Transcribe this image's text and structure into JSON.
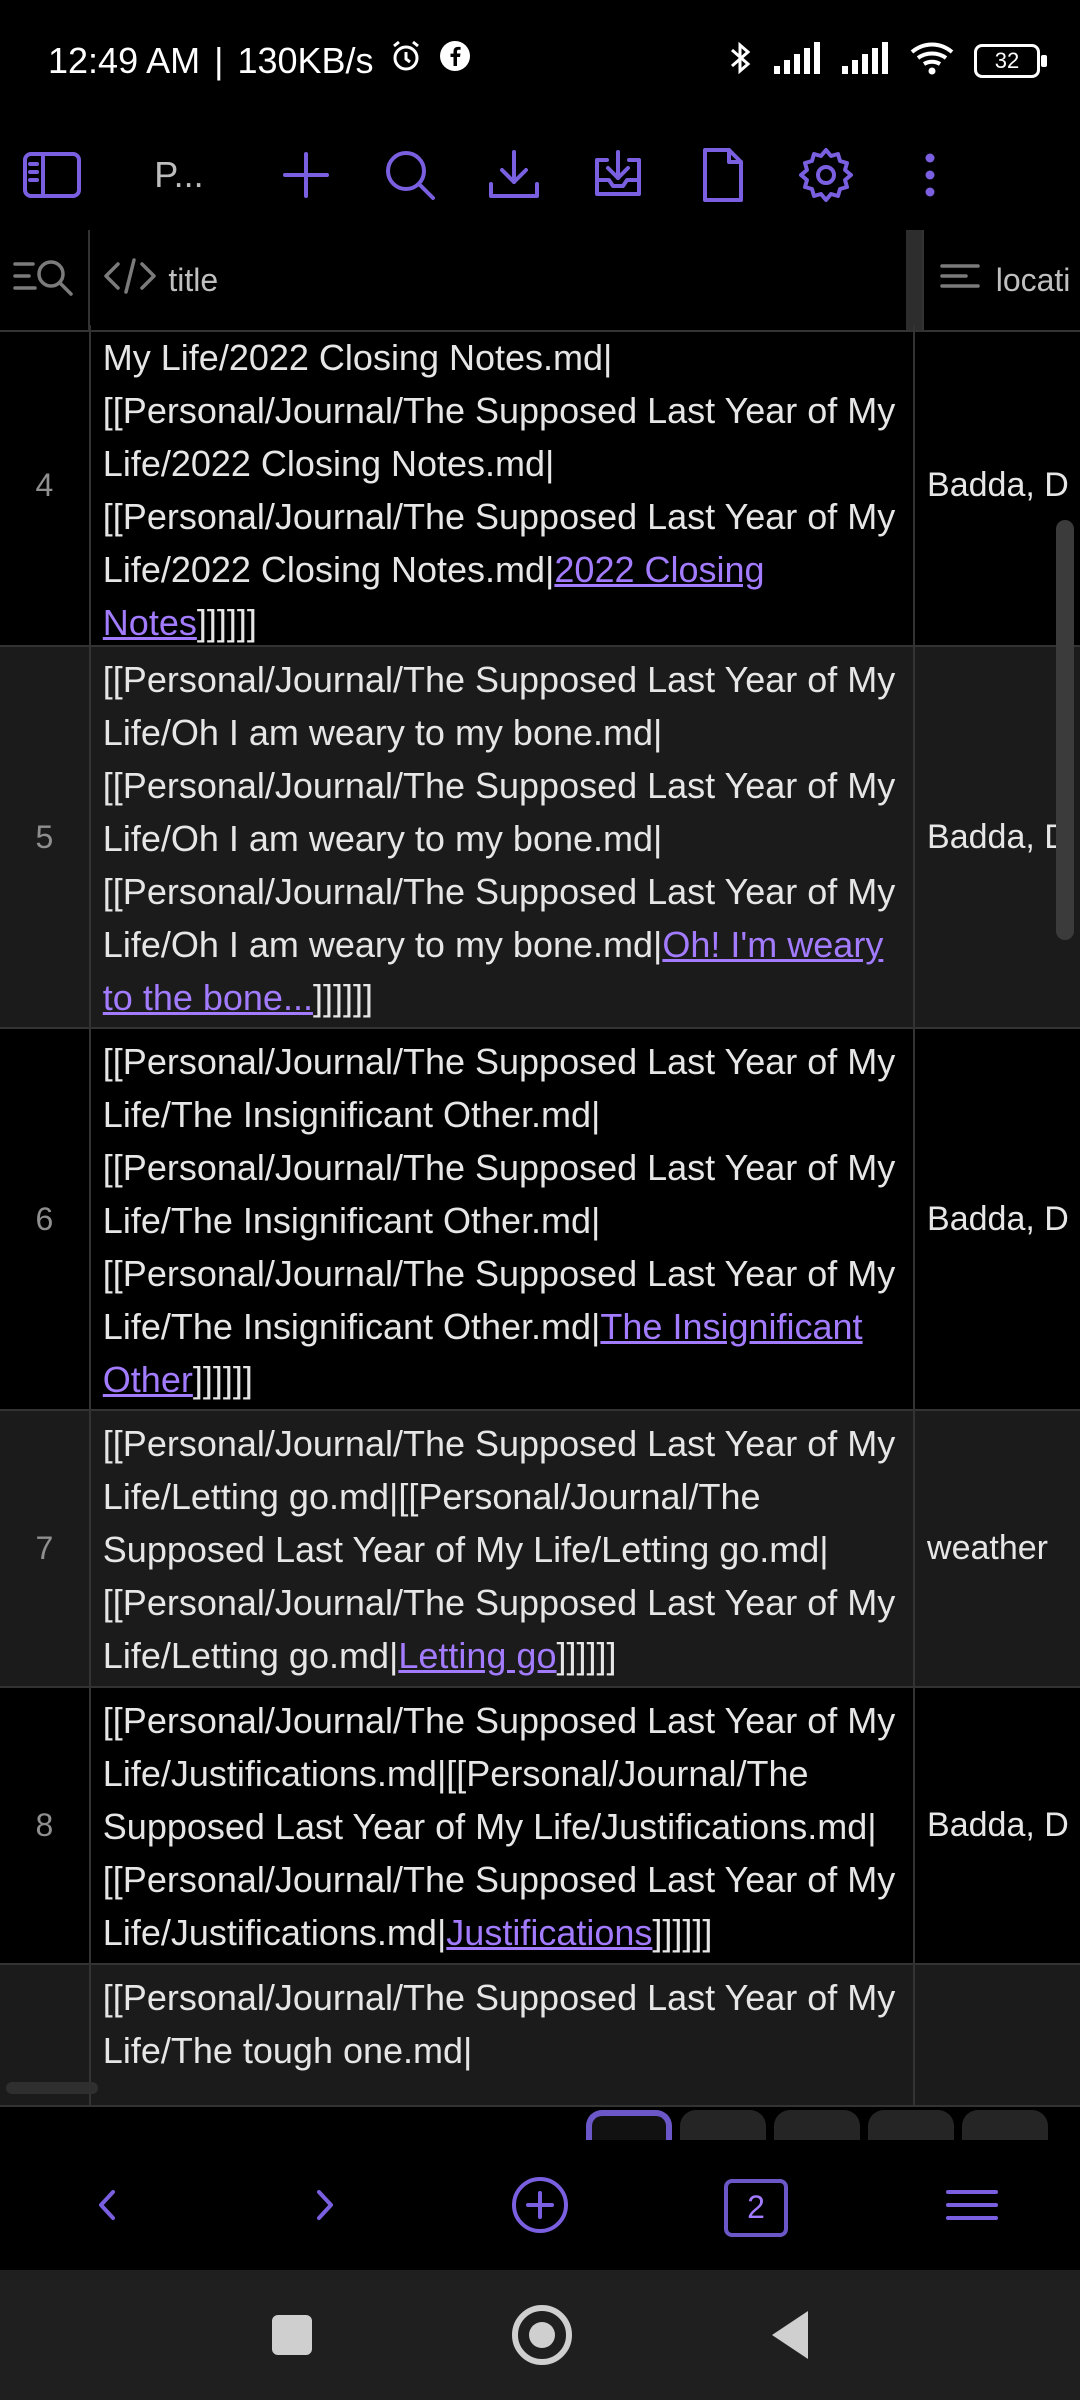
{
  "status": {
    "time": "12:49 AM",
    "speed": "130KB/s",
    "battery": "32"
  },
  "toolbar": {
    "title": "P..."
  },
  "table": {
    "headers": {
      "title": "title",
      "location": "locati"
    },
    "rows": [
      {
        "num": "4",
        "prefix": "My Life/2022 Closing Notes.md|\n[[Personal/Journal/The Supposed Last Year of My Life/2022 Closing Notes.md|\n[[Personal/Journal/The Supposed Last Year of My Life/2022 Closing Notes.md|",
        "link": "2022 Closing Notes",
        "suffix": "]]]]]]",
        "location": "Badda, D"
      },
      {
        "num": "5",
        "prefix": "[[Personal/Journal/The Supposed Last Year of My Life/Oh I am weary to my bone.md|\n[[Personal/Journal/The Supposed Last Year of My Life/Oh I am weary to my bone.md|\n[[Personal/Journal/The Supposed Last Year of My Life/Oh I am weary to my bone.md|",
        "link": "Oh! I'm weary to the bone...",
        "suffix": "]]]]]]",
        "location": "Badda, D"
      },
      {
        "num": "6",
        "prefix": "[[Personal/Journal/The Supposed Last Year of My Life/The Insignificant Other.md|\n[[Personal/Journal/The Supposed Last Year of My Life/The Insignificant Other.md|\n[[Personal/Journal/The Supposed Last Year of My Life/The Insignificant Other.md|",
        "link": "The Insignificant Other",
        "suffix": "]]]]]]",
        "location": "Badda, D"
      },
      {
        "num": "7",
        "prefix": "[[Personal/Journal/The Supposed Last Year of My Life/Letting go.md|[[Personal/Journal/The Supposed Last Year of My Life/Letting go.md|\n[[Personal/Journal/The Supposed Last Year of My Life/Letting go.md|",
        "link": "Letting go",
        "suffix": "]]]]]]",
        "location": "weather"
      },
      {
        "num": "8",
        "prefix": "[[Personal/Journal/The Supposed Last Year of My Life/Justifications.md|[[Personal/Journal/The Supposed Last Year of My Life/Justifications.md|\n[[Personal/Journal/The Supposed Last Year of My Life/Justifications.md|",
        "link": "Justifications",
        "suffix": "]]]]]]",
        "location": "Badda, D"
      },
      {
        "num": "",
        "prefix": "[[Personal/Journal/The Supposed Last Year of My Life/The tough one.md|",
        "link": "",
        "suffix": "",
        "location": ""
      }
    ]
  },
  "bottom_nav": {
    "tab_count": "2"
  },
  "colors": {
    "accent": "#7a60e0",
    "link": "#a27bff",
    "background": "#000000",
    "alt_row": "#1b1b1b"
  }
}
